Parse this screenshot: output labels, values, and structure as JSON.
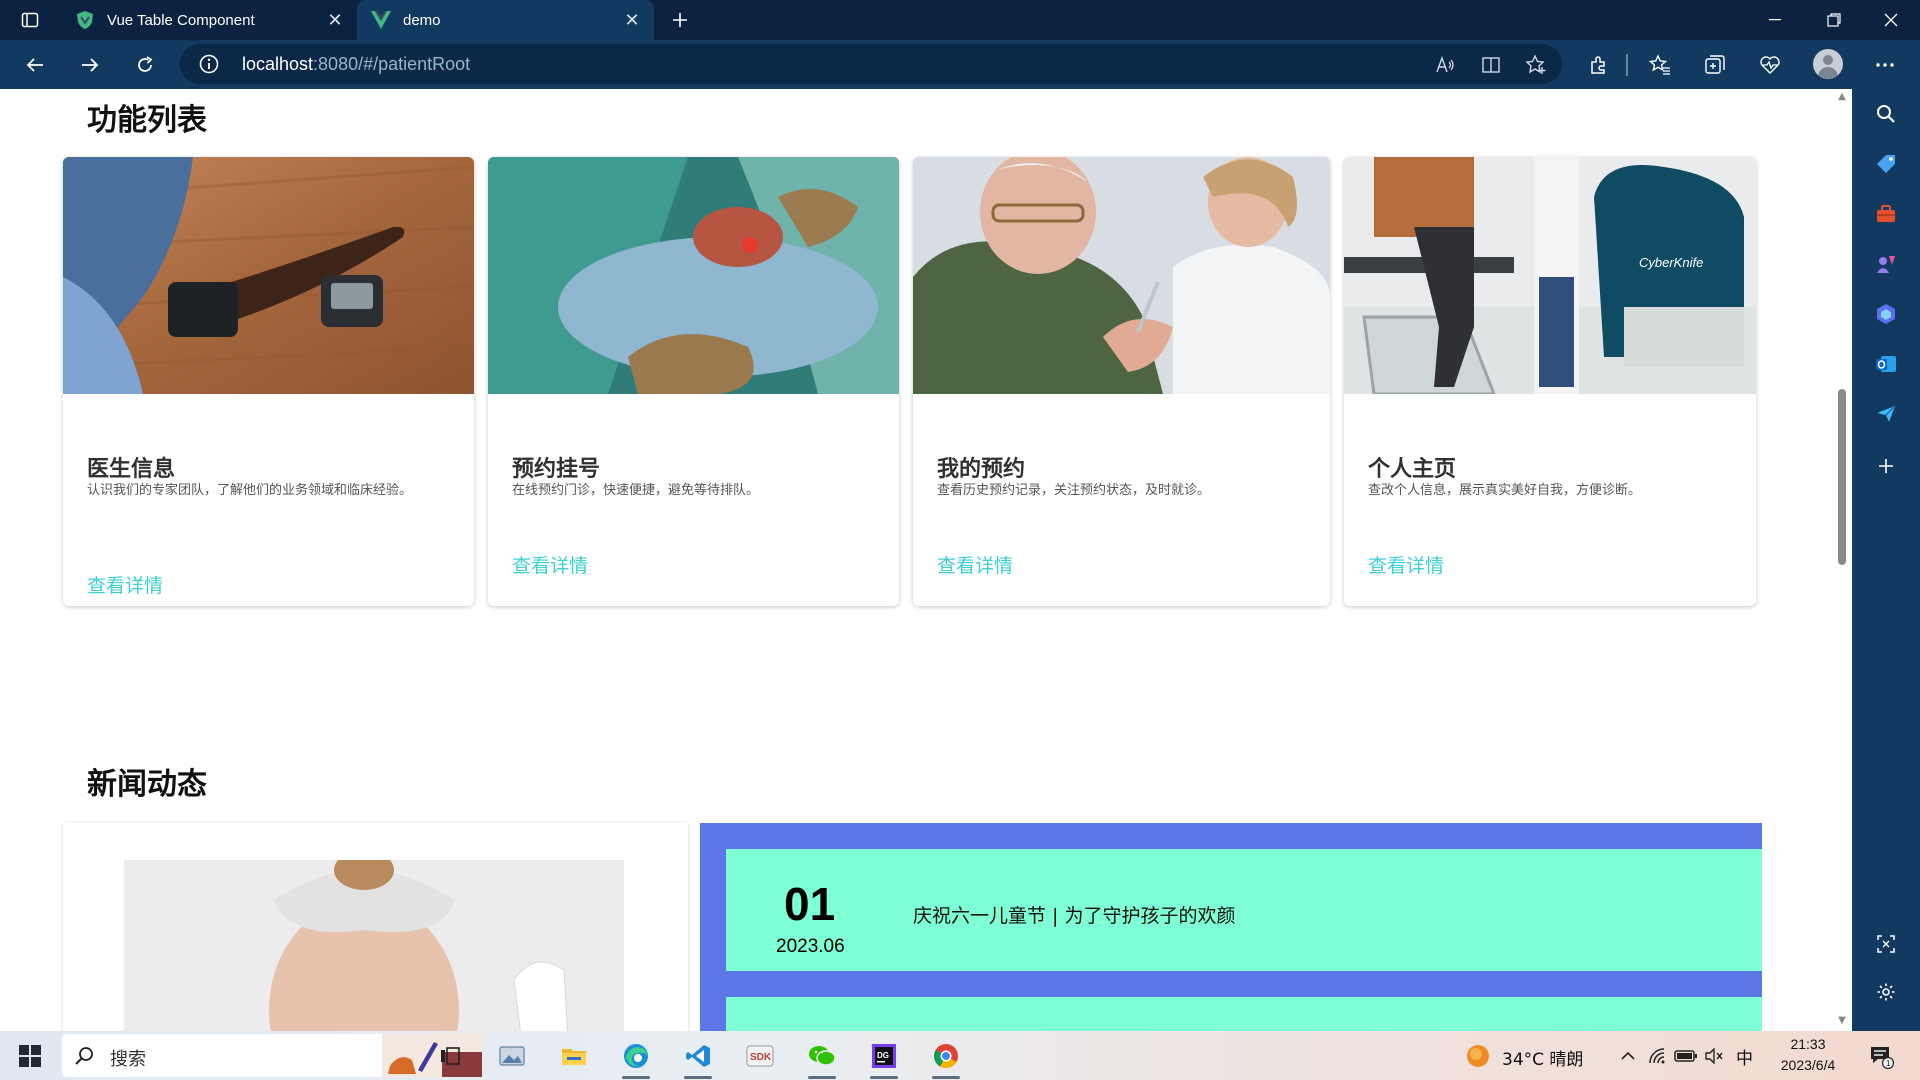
{
  "browser": {
    "tabs": [
      {
        "title": "Vue Table Component"
      },
      {
        "title": "demo"
      }
    ],
    "url": {
      "host": "localhost",
      "rest": ":8080/#/patientRoot"
    }
  },
  "features": {
    "heading": "功能列表",
    "cards": [
      {
        "title": "医生信息",
        "desc": "认识我们的专家团队，了解他们的业务领域和临床经验。",
        "link": "查看详情"
      },
      {
        "title": "预约挂号",
        "desc": "在线预约门诊，快速便捷，避免等待排队。",
        "link": "查看详情"
      },
      {
        "title": "我的预约",
        "desc": "查看历史预约记录，关注预约状态，及时就诊。",
        "link": "查看详情"
      },
      {
        "title": "个人主页",
        "desc": "查改个人信息，展示真实美好自我，方便诊断。",
        "link": "查看详情"
      }
    ]
  },
  "news": {
    "heading": "新闻动态",
    "items": [
      {
        "day": "01",
        "month": "2023.06",
        "headline": "庆祝六一儿童节 | 为了守护孩子的欢颜"
      }
    ]
  },
  "taskbar": {
    "search_label": "搜索",
    "weather": "34°C  晴朗",
    "ime": "中",
    "time": "21:33",
    "date": "2023/6/4",
    "notification_count": "1"
  },
  "colors": {
    "link": "#3ed0d0",
    "news_panel": "#5b78e6",
    "news_item": "#7fffd4",
    "browser_frame": "#12395f"
  }
}
